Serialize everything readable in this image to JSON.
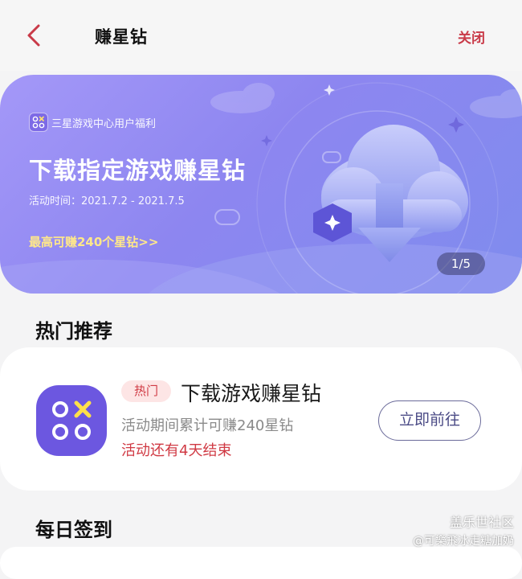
{
  "header": {
    "title": "赚星钻",
    "close_label": "关闭",
    "back_icon": "chevron-left-icon",
    "accent_color": "#c93a48"
  },
  "banner": {
    "brand_text": "三星游戏中心用户福利",
    "title": "下载指定游戏赚星钻",
    "date_text": "活动时间：2021.7.2 - 2021.7.5",
    "promo_text": "最高可赚240个星钻>>",
    "pager_text": "1/5",
    "icons": [
      "cloud-download-icon",
      "diamond-icon",
      "sparkle-icon",
      "gamepad-icon"
    ]
  },
  "sections": {
    "hot_title": "热门推荐",
    "daily_title": "每日签到"
  },
  "hot_card": {
    "badge": "热门",
    "title": "下载游戏赚星钻",
    "subtitle": "活动期间累计可赚240星钻",
    "countdown": "活动还有4天结束",
    "button_label": "立即前往",
    "icon": "game-center-app-icon"
  },
  "watermark": {
    "line1": "盖乐世社区",
    "line2": "@可樂飛冰走糖加奶"
  }
}
